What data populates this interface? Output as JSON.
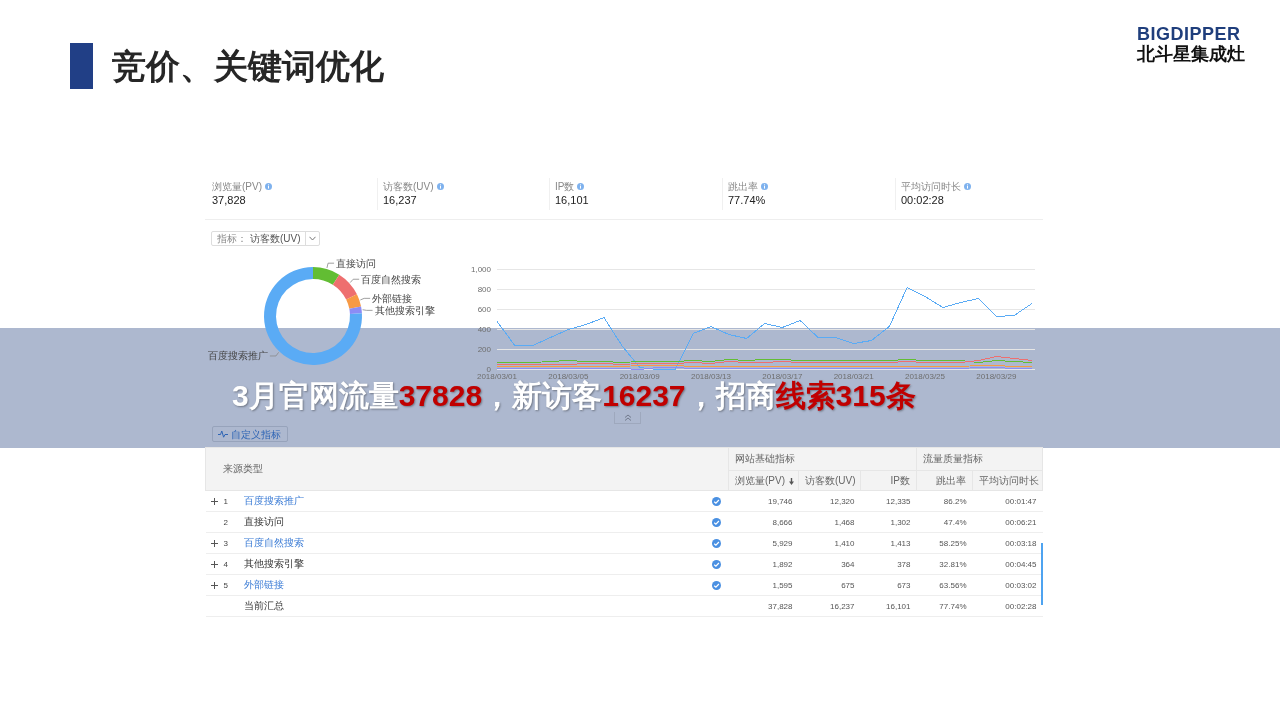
{
  "slide": {
    "title": "竞价、关键词优化"
  },
  "logo": {
    "wordmark": "BIGDIPPER",
    "name": "北斗星集成灶"
  },
  "metrics": [
    {
      "label": "浏览量(PV)",
      "value": "37,828"
    },
    {
      "label": "访客数(UV)",
      "value": "16,237"
    },
    {
      "label": "IP数",
      "value": "16,101"
    },
    {
      "label": "跳出率",
      "value": "77.74%"
    },
    {
      "label": "平均访问时长",
      "value": "00:02:28"
    }
  ],
  "metric_select": {
    "label": "指标：",
    "value": "访客数(UV)"
  },
  "source_share": {
    "chart_data": {
      "type": "donut",
      "categories": [
        "直接访问",
        "百度自然搜索",
        "外部链接",
        "其他搜索引擎",
        "百度搜索推广"
      ],
      "colors": [
        "#62bd33",
        "#ee6f6f",
        "#f79a45",
        "#8c8cf5",
        "#5aabf5"
      ],
      "values": [
        9.0,
        8.7,
        4.2,
        2.2,
        75.9
      ]
    }
  },
  "trend": {
    "chart_data": {
      "type": "line",
      "grid": true,
      "categories": [
        "2018/03/01",
        null,
        null,
        null,
        "2018/03/05",
        null,
        null,
        null,
        "2018/03/09",
        null,
        null,
        null,
        "2018/03/13",
        null,
        null,
        null,
        "2018/03/17",
        null,
        null,
        null,
        "2018/03/21",
        null,
        null,
        null,
        "2018/03/25",
        null,
        null,
        null,
        "2018/03/29",
        null,
        null
      ],
      "ylim": [
        0,
        1000
      ],
      "yticks": [
        0,
        200,
        400,
        600,
        800,
        {
          "value": 1000,
          "label": "1,000"
        }
      ],
      "series": [
        {
          "color": "#5aabf5",
          "values": [
            480,
            240,
            240,
            320,
            400,
            450,
            520,
            240,
            20,
            0,
            0,
            360,
            430,
            350,
            310,
            460,
            420,
            490,
            320,
            320,
            260,
            290,
            430,
            820,
            730,
            620,
            670,
            710,
            530,
            540,
            660
          ]
        },
        {
          "color": "#62bd33",
          "values": [
            70,
            70,
            70,
            80,
            90,
            80,
            80,
            70,
            80,
            80,
            80,
            90,
            80,
            100,
            90,
            100,
            100,
            90,
            90,
            90,
            90,
            90,
            90,
            100,
            90,
            90,
            90,
            70,
            90,
            80,
            70
          ]
        },
        {
          "color": "#ee6f6f",
          "values": [
            50,
            50,
            50,
            50,
            50,
            60,
            60,
            50,
            60,
            60,
            60,
            70,
            60,
            80,
            70,
            70,
            80,
            70,
            70,
            70,
            70,
            70,
            70,
            80,
            70,
            70,
            70,
            90,
            130,
            110,
            90
          ]
        },
        {
          "color": "#f79a45",
          "values": [
            30,
            30,
            30,
            30,
            30,
            30,
            30,
            30,
            40,
            40,
            40,
            30,
            30,
            30,
            30,
            30,
            30,
            30,
            30,
            30,
            30,
            30,
            30,
            30,
            30,
            30,
            30,
            40,
            40,
            30,
            30
          ]
        },
        {
          "color": "#8c8cf5",
          "values": [
            10,
            10,
            10,
            10,
            10,
            10,
            10,
            10,
            0,
            20,
            20,
            10,
            10,
            10,
            10,
            10,
            10,
            10,
            10,
            10,
            10,
            10,
            10,
            10,
            10,
            10,
            10,
            20,
            20,
            10,
            10
          ]
        }
      ]
    }
  },
  "banner": {
    "segments": [
      {
        "text": "3月官网流量",
        "highlight": false
      },
      {
        "text": "37828",
        "highlight": true
      },
      {
        "text": "，新访客",
        "highlight": false
      },
      {
        "text": "16237",
        "highlight": true
      },
      {
        "text": "，招商",
        "highlight": false
      },
      {
        "text": "线索315条",
        "highlight": true
      }
    ]
  },
  "custom_metrics_button": {
    "label": "自定义指标"
  },
  "table": {
    "source_column": "来源类型",
    "groups": [
      {
        "label": "网站基础指标",
        "columns": [
          {
            "label": "浏览量(PV)",
            "sorted": true
          },
          {
            "label": "访客数(UV)",
            "sorted": false
          },
          {
            "label": "IP数",
            "sorted": false
          }
        ]
      },
      {
        "label": "流量质量指标",
        "columns": [
          {
            "label": "跳出率",
            "sorted": false
          },
          {
            "label": "平均访问时长",
            "sorted": false
          }
        ]
      }
    ],
    "rows": [
      {
        "expandable": true,
        "index": "1",
        "name": "百度搜索推广",
        "linked": true,
        "values": [
          "19,746",
          "12,320",
          "12,335",
          "86.2%",
          "00:01:47"
        ]
      },
      {
        "expandable": false,
        "index": "2",
        "name": "直接访问",
        "linked": false,
        "values": [
          "8,666",
          "1,468",
          "1,302",
          "47.4%",
          "00:06:21"
        ]
      },
      {
        "expandable": true,
        "index": "3",
        "name": "百度自然搜索",
        "linked": true,
        "values": [
          "5,929",
          "1,410",
          "1,413",
          "58.25%",
          "00:03:18"
        ]
      },
      {
        "expandable": true,
        "index": "4",
        "name": "其他搜索引擎",
        "linked": false,
        "values": [
          "1,892",
          "364",
          "378",
          "32.81%",
          "00:04:45"
        ]
      },
      {
        "expandable": true,
        "index": "5",
        "name": "外部链接",
        "linked": true,
        "values": [
          "1,595",
          "675",
          "673",
          "63.56%",
          "00:03:02"
        ]
      }
    ],
    "total": {
      "label": "当前汇总",
      "values": [
        "37,828",
        "16,237",
        "16,101",
        "77.74%",
        "00:02:28"
      ]
    }
  }
}
